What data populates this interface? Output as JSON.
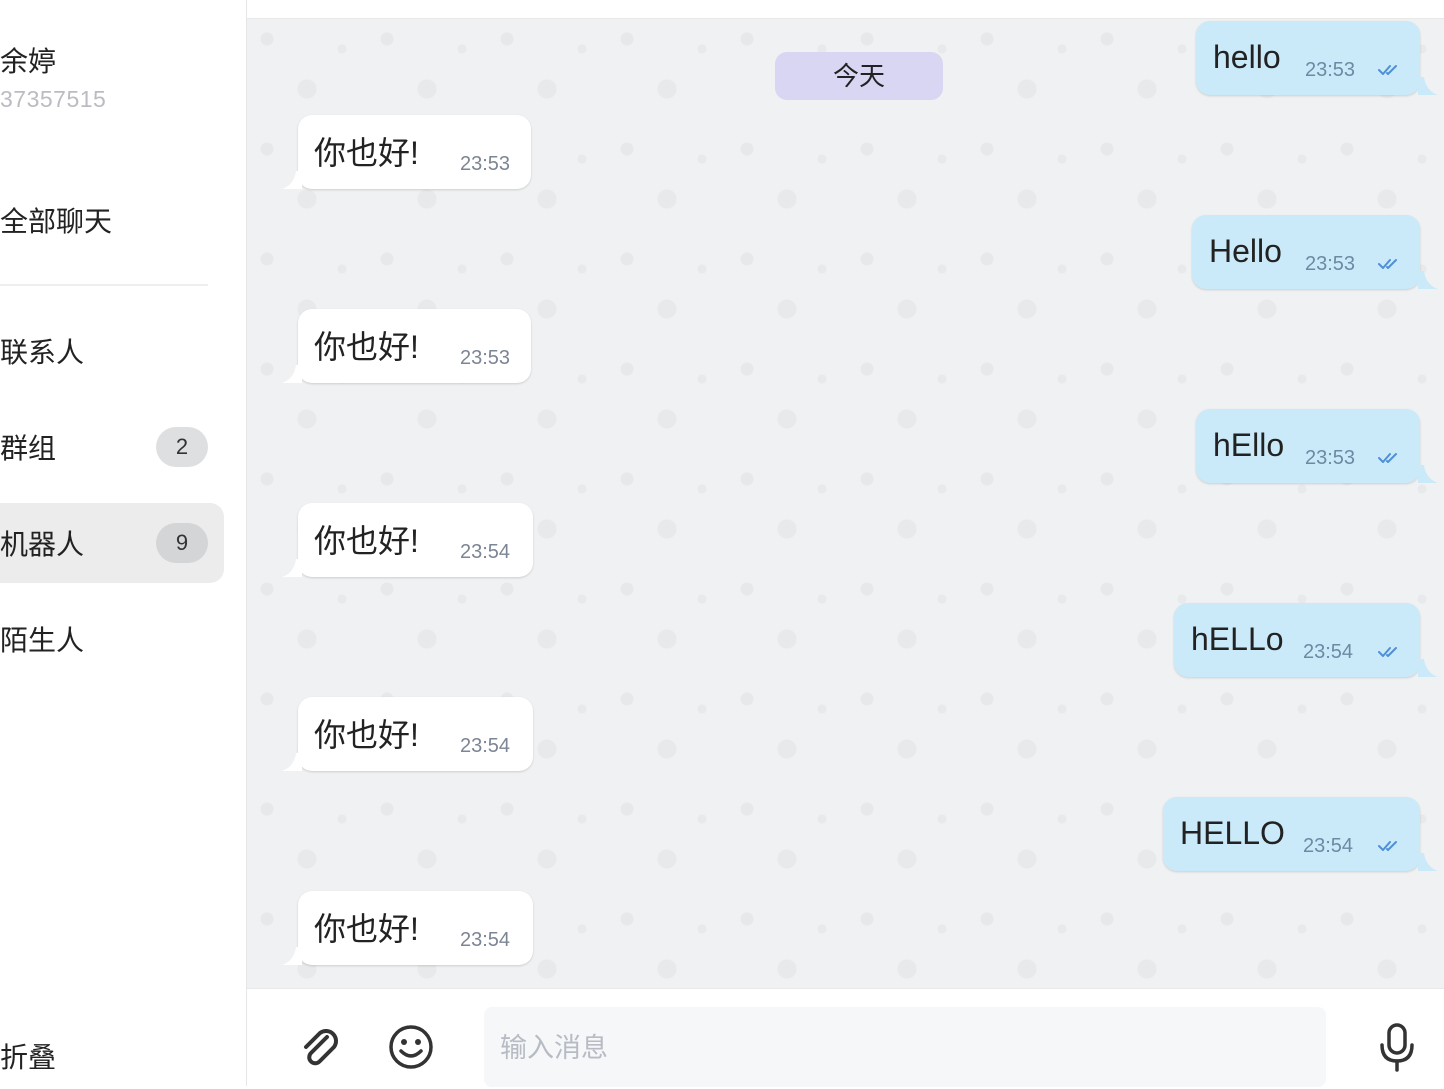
{
  "sidebar": {
    "user_name": "余婷",
    "user_id": "37357515",
    "all_chats": "全部聊天",
    "items": [
      {
        "label": "联系人",
        "badge": ""
      },
      {
        "label": "群组",
        "badge": "2"
      },
      {
        "label": "机器人",
        "badge": "9",
        "active": true
      },
      {
        "label": "陌生人",
        "badge": ""
      }
    ],
    "collapse": "折叠"
  },
  "chat": {
    "date_label": "今天",
    "messages": [
      {
        "direction": "out",
        "text": "hello",
        "time": "23:53",
        "status": "read"
      },
      {
        "direction": "in",
        "text": "你也好!",
        "time": "23:53"
      },
      {
        "direction": "out",
        "text": "Hello",
        "time": "23:53",
        "status": "read"
      },
      {
        "direction": "in",
        "text": "你也好!",
        "time": "23:53"
      },
      {
        "direction": "out",
        "text": "hEllo",
        "time": "23:53",
        "status": "read"
      },
      {
        "direction": "in",
        "text": "你也好!",
        "time": "23:54"
      },
      {
        "direction": "out",
        "text": "hELLo",
        "time": "23:54",
        "status": "read"
      },
      {
        "direction": "in",
        "text": "你也好!",
        "time": "23:54"
      },
      {
        "direction": "out",
        "text": "HELLO",
        "time": "23:54",
        "status": "read"
      },
      {
        "direction": "in",
        "text": "你也好!",
        "time": "23:54"
      }
    ]
  },
  "composer": {
    "placeholder": "输入消息",
    "attach_icon": "paperclip-icon",
    "emoji_icon": "emoji-icon",
    "mic_icon": "microphone-icon"
  },
  "colors": {
    "outgoing_bubble": "#cbeaf9",
    "incoming_bubble": "#ffffff",
    "date_chip": "#d8d6f2",
    "chat_background": "#eff1f2",
    "active_nav": "#ececed"
  }
}
